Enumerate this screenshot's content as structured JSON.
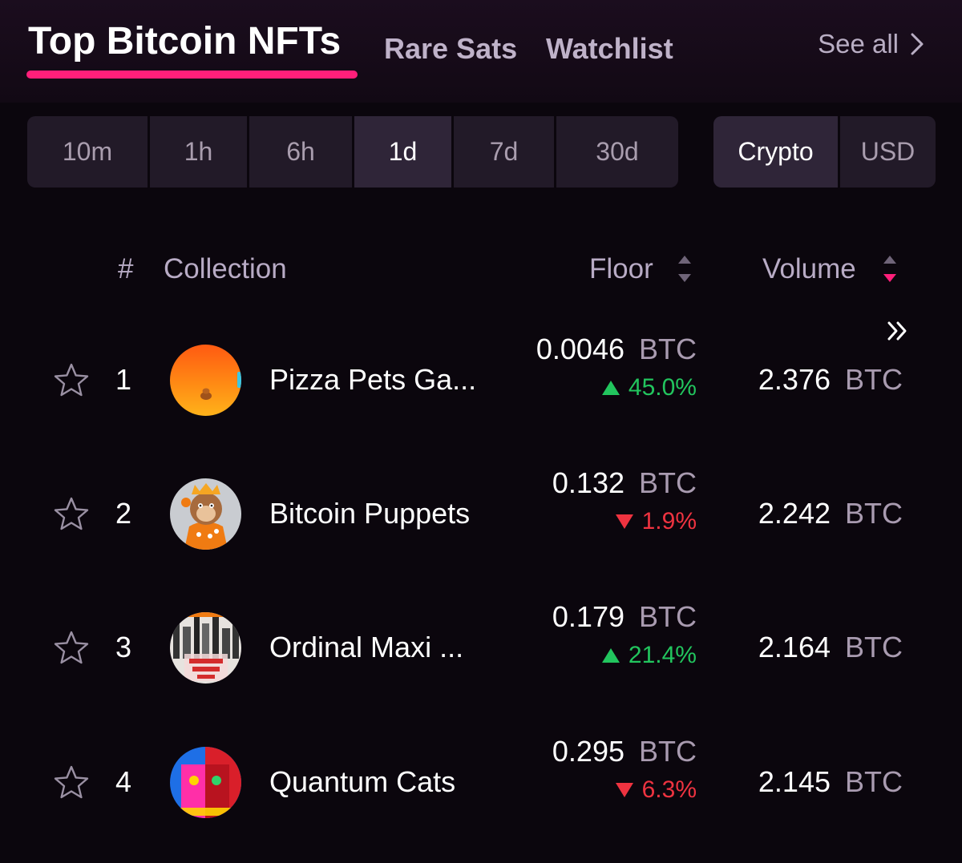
{
  "tabs": {
    "top_label": "Top Bitcoin NFTs",
    "rare_label": "Rare Sats",
    "watch_label": "Watchlist",
    "see_all": "See all"
  },
  "time_filters": [
    "10m",
    "1h",
    "6h",
    "1d",
    "7d",
    "30d"
  ],
  "time_selected": "1d",
  "currency_filters": [
    "Crypto",
    "USD"
  ],
  "currency_selected": "Crypto",
  "columns": {
    "hash": "#",
    "collection": "Collection",
    "floor": "Floor",
    "volume": "Volume"
  },
  "rows": [
    {
      "rank": "1",
      "name": "Pizza Pets Ga...",
      "floor": "0.0046",
      "floor_unit": "BTC",
      "change": "45.0%",
      "direction": "up",
      "volume": "2.376",
      "volume_unit": "BTC"
    },
    {
      "rank": "2",
      "name": "Bitcoin Puppets",
      "floor": "0.132",
      "floor_unit": "BTC",
      "change": "1.9%",
      "direction": "down",
      "volume": "2.242",
      "volume_unit": "BTC"
    },
    {
      "rank": "3",
      "name": "Ordinal Maxi ...",
      "floor": "0.179",
      "floor_unit": "BTC",
      "change": "21.4%",
      "direction": "up",
      "volume": "2.164",
      "volume_unit": "BTC"
    },
    {
      "rank": "4",
      "name": "Quantum Cats",
      "floor": "0.295",
      "floor_unit": "BTC",
      "change": "6.3%",
      "direction": "down",
      "volume": "2.145",
      "volume_unit": "BTC"
    }
  ],
  "colors": {
    "accent": "#ff1f7a",
    "up": "#22c55e",
    "down": "#ef3340",
    "background": "#0b060d"
  }
}
